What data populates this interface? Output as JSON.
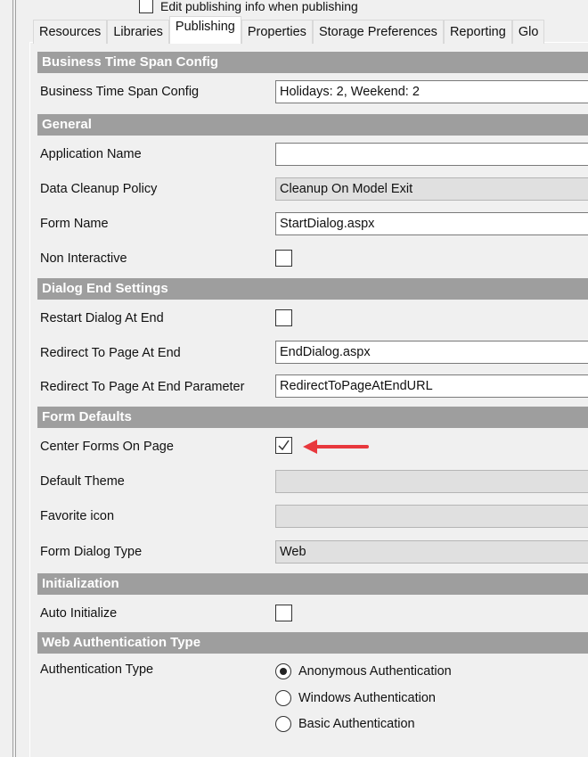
{
  "top_checkbox": {
    "label": "Edit publishing info when publishing",
    "checked": false
  },
  "tabs": [
    "Resources",
    "Libraries",
    "Publishing",
    "Properties",
    "Storage Preferences",
    "Reporting",
    "Glo"
  ],
  "active_tab": "Publishing",
  "sections": {
    "business": {
      "title": "Business Time Span Config",
      "label": "Business Time Span Config",
      "value": "Holidays: 2, Weekend: 2"
    },
    "general": {
      "title": "General",
      "app_name_label": "Application Name",
      "app_name_value": "",
      "cleanup_label": "Data Cleanup Policy",
      "cleanup_value": "Cleanup On Model Exit",
      "form_name_label": "Form Name",
      "form_name_value": "StartDialog.aspx",
      "non_interactive_label": "Non Interactive",
      "non_interactive_checked": false
    },
    "dialog_end": {
      "title": "Dialog End Settings",
      "restart_label": "Restart Dialog At End",
      "restart_checked": false,
      "redirect_label": "Redirect To Page At End",
      "redirect_value": "EndDialog.aspx",
      "redirect_param_label": "Redirect To Page At End Parameter",
      "redirect_param_value": "RedirectToPageAtEndURL"
    },
    "form_defaults": {
      "title": "Form Defaults",
      "center_label": "Center Forms On Page",
      "center_checked": true,
      "theme_label": "Default Theme",
      "theme_value": "",
      "favicon_label": "Favorite icon",
      "favicon_value": "",
      "dialog_type_label": "Form Dialog Type",
      "dialog_type_value": "Web"
    },
    "initialization": {
      "title": "Initialization",
      "auto_label": "Auto Initialize",
      "auto_checked": false
    },
    "web_auth": {
      "title": "Web Authentication Type",
      "label": "Authentication Type",
      "options": [
        "Anonymous Authentication",
        "Windows Authentication",
        "Basic Authentication"
      ],
      "selected": "Anonymous Authentication"
    }
  },
  "colors": {
    "section_header": "#9e9e9e",
    "arrow": "#e8383d"
  }
}
